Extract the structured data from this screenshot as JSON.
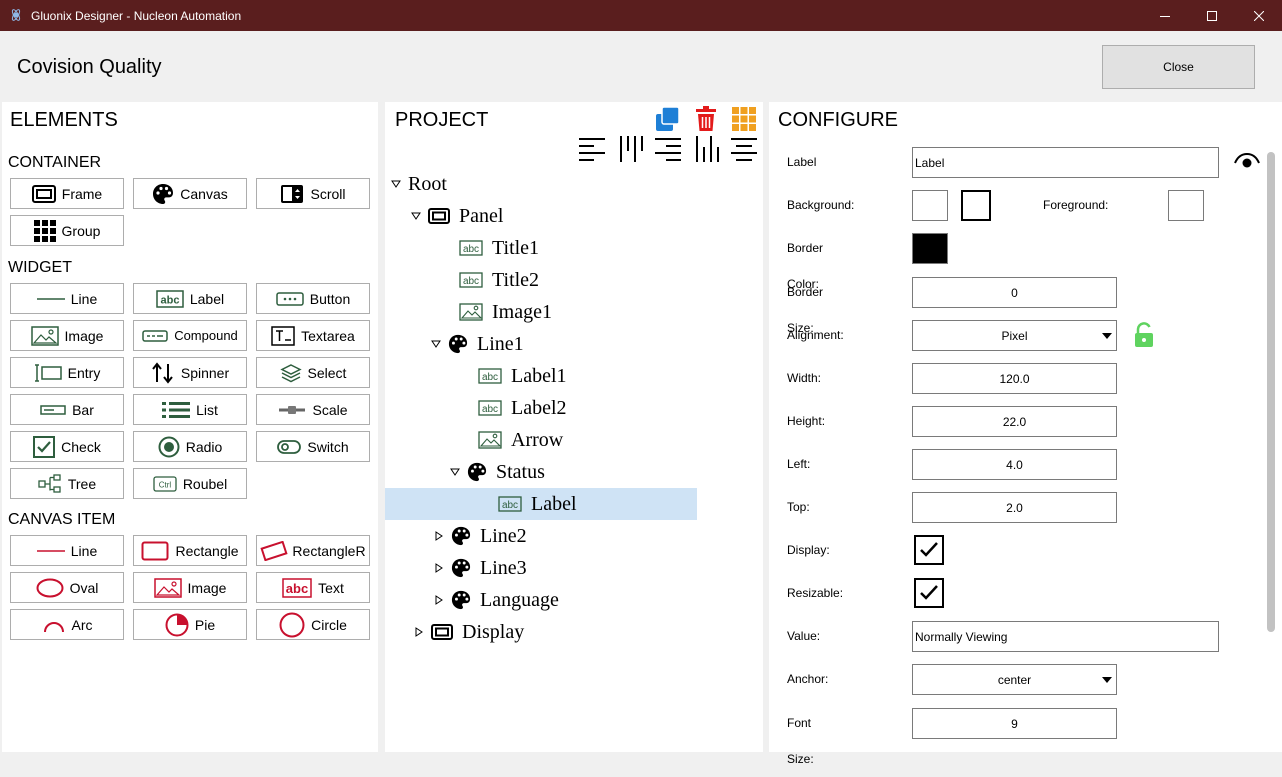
{
  "window": {
    "title": "Gluonix Designer - Nucleon Automation"
  },
  "header": {
    "title": "Covision Quality",
    "close_label": "Close"
  },
  "elements": {
    "title": "ELEMENTS",
    "sections": {
      "container": "CONTAINER",
      "widget": "WIDGET",
      "canvas": "CANVAS ITEM"
    },
    "container": [
      "Frame",
      "Canvas",
      "Scroll",
      "Group"
    ],
    "widget": [
      "Line",
      "Label",
      "Button",
      "Image",
      "Compound",
      "Textarea",
      "Entry",
      "Spinner",
      "Select",
      "Bar",
      "List",
      "Scale",
      "Check",
      "Radio",
      "Switch",
      "Tree",
      "Roubel"
    ],
    "canvas": [
      "Line",
      "Rectangle",
      "RectangleR",
      "Oval",
      "Image",
      "Text",
      "Arc",
      "Pie",
      "Circle"
    ]
  },
  "project": {
    "title": "PROJECT",
    "tree": [
      {
        "label": "Root",
        "icon": "none",
        "expand": "open"
      },
      {
        "label": "Panel",
        "icon": "frame-icon",
        "expand": "open"
      },
      {
        "label": "Title1",
        "icon": "label-icon",
        "expand": "none"
      },
      {
        "label": "Title2",
        "icon": "label-icon",
        "expand": "none"
      },
      {
        "label": "Image1",
        "icon": "image-icon",
        "expand": "none"
      },
      {
        "label": "Line1",
        "icon": "canvas-icon",
        "expand": "open"
      },
      {
        "label": "Label1",
        "icon": "label-icon",
        "expand": "none"
      },
      {
        "label": "Label2",
        "icon": "label-icon",
        "expand": "none"
      },
      {
        "label": "Arrow",
        "icon": "image-icon",
        "expand": "none"
      },
      {
        "label": "Status",
        "icon": "canvas-icon",
        "expand": "open"
      },
      {
        "label": "Label",
        "icon": "label-icon",
        "expand": "none",
        "selected": true
      },
      {
        "label": "Line2",
        "icon": "canvas-icon",
        "expand": "closed"
      },
      {
        "label": "Line3",
        "icon": "canvas-icon",
        "expand": "closed"
      },
      {
        "label": "Language",
        "icon": "canvas-icon",
        "expand": "closed"
      },
      {
        "label": "Display",
        "icon": "frame-icon",
        "expand": "closed"
      }
    ]
  },
  "configure": {
    "title": "CONFIGURE",
    "label": {
      "name": "Label",
      "value": "Label"
    },
    "background": {
      "name": "Background:"
    },
    "foreground": {
      "name": "Foreground:"
    },
    "border_color": {
      "name": "Border Color:",
      "color": "#000000"
    },
    "border_size": {
      "name": "Border Size:",
      "value": "0"
    },
    "alignment": {
      "name": "Alignment:",
      "value": "Pixel"
    },
    "width": {
      "name": "Width:",
      "value": "120.0"
    },
    "height": {
      "name": "Height:",
      "value": "22.0"
    },
    "left": {
      "name": "Left:",
      "value": "4.0"
    },
    "top": {
      "name": "Top:",
      "value": "2.0"
    },
    "display": {
      "name": "Display:",
      "checked": true
    },
    "resizable": {
      "name": "Resizable:",
      "checked": true
    },
    "value": {
      "name": "Value:",
      "value": "Normally Viewing"
    },
    "anchor": {
      "name": "Anchor:",
      "value": "center"
    },
    "font_size": {
      "name": "Font Size:",
      "value": "9"
    }
  },
  "colors": {
    "titlebar": "#5a1e1e",
    "selection": "#cfe3f5",
    "widget_icon": "#2e5e3e",
    "canvas_icon": "#c8102e",
    "copy": "#1e7fd6",
    "delete": "#e31b1b",
    "grid": "#f0a020",
    "lock": "#5fd35f"
  }
}
